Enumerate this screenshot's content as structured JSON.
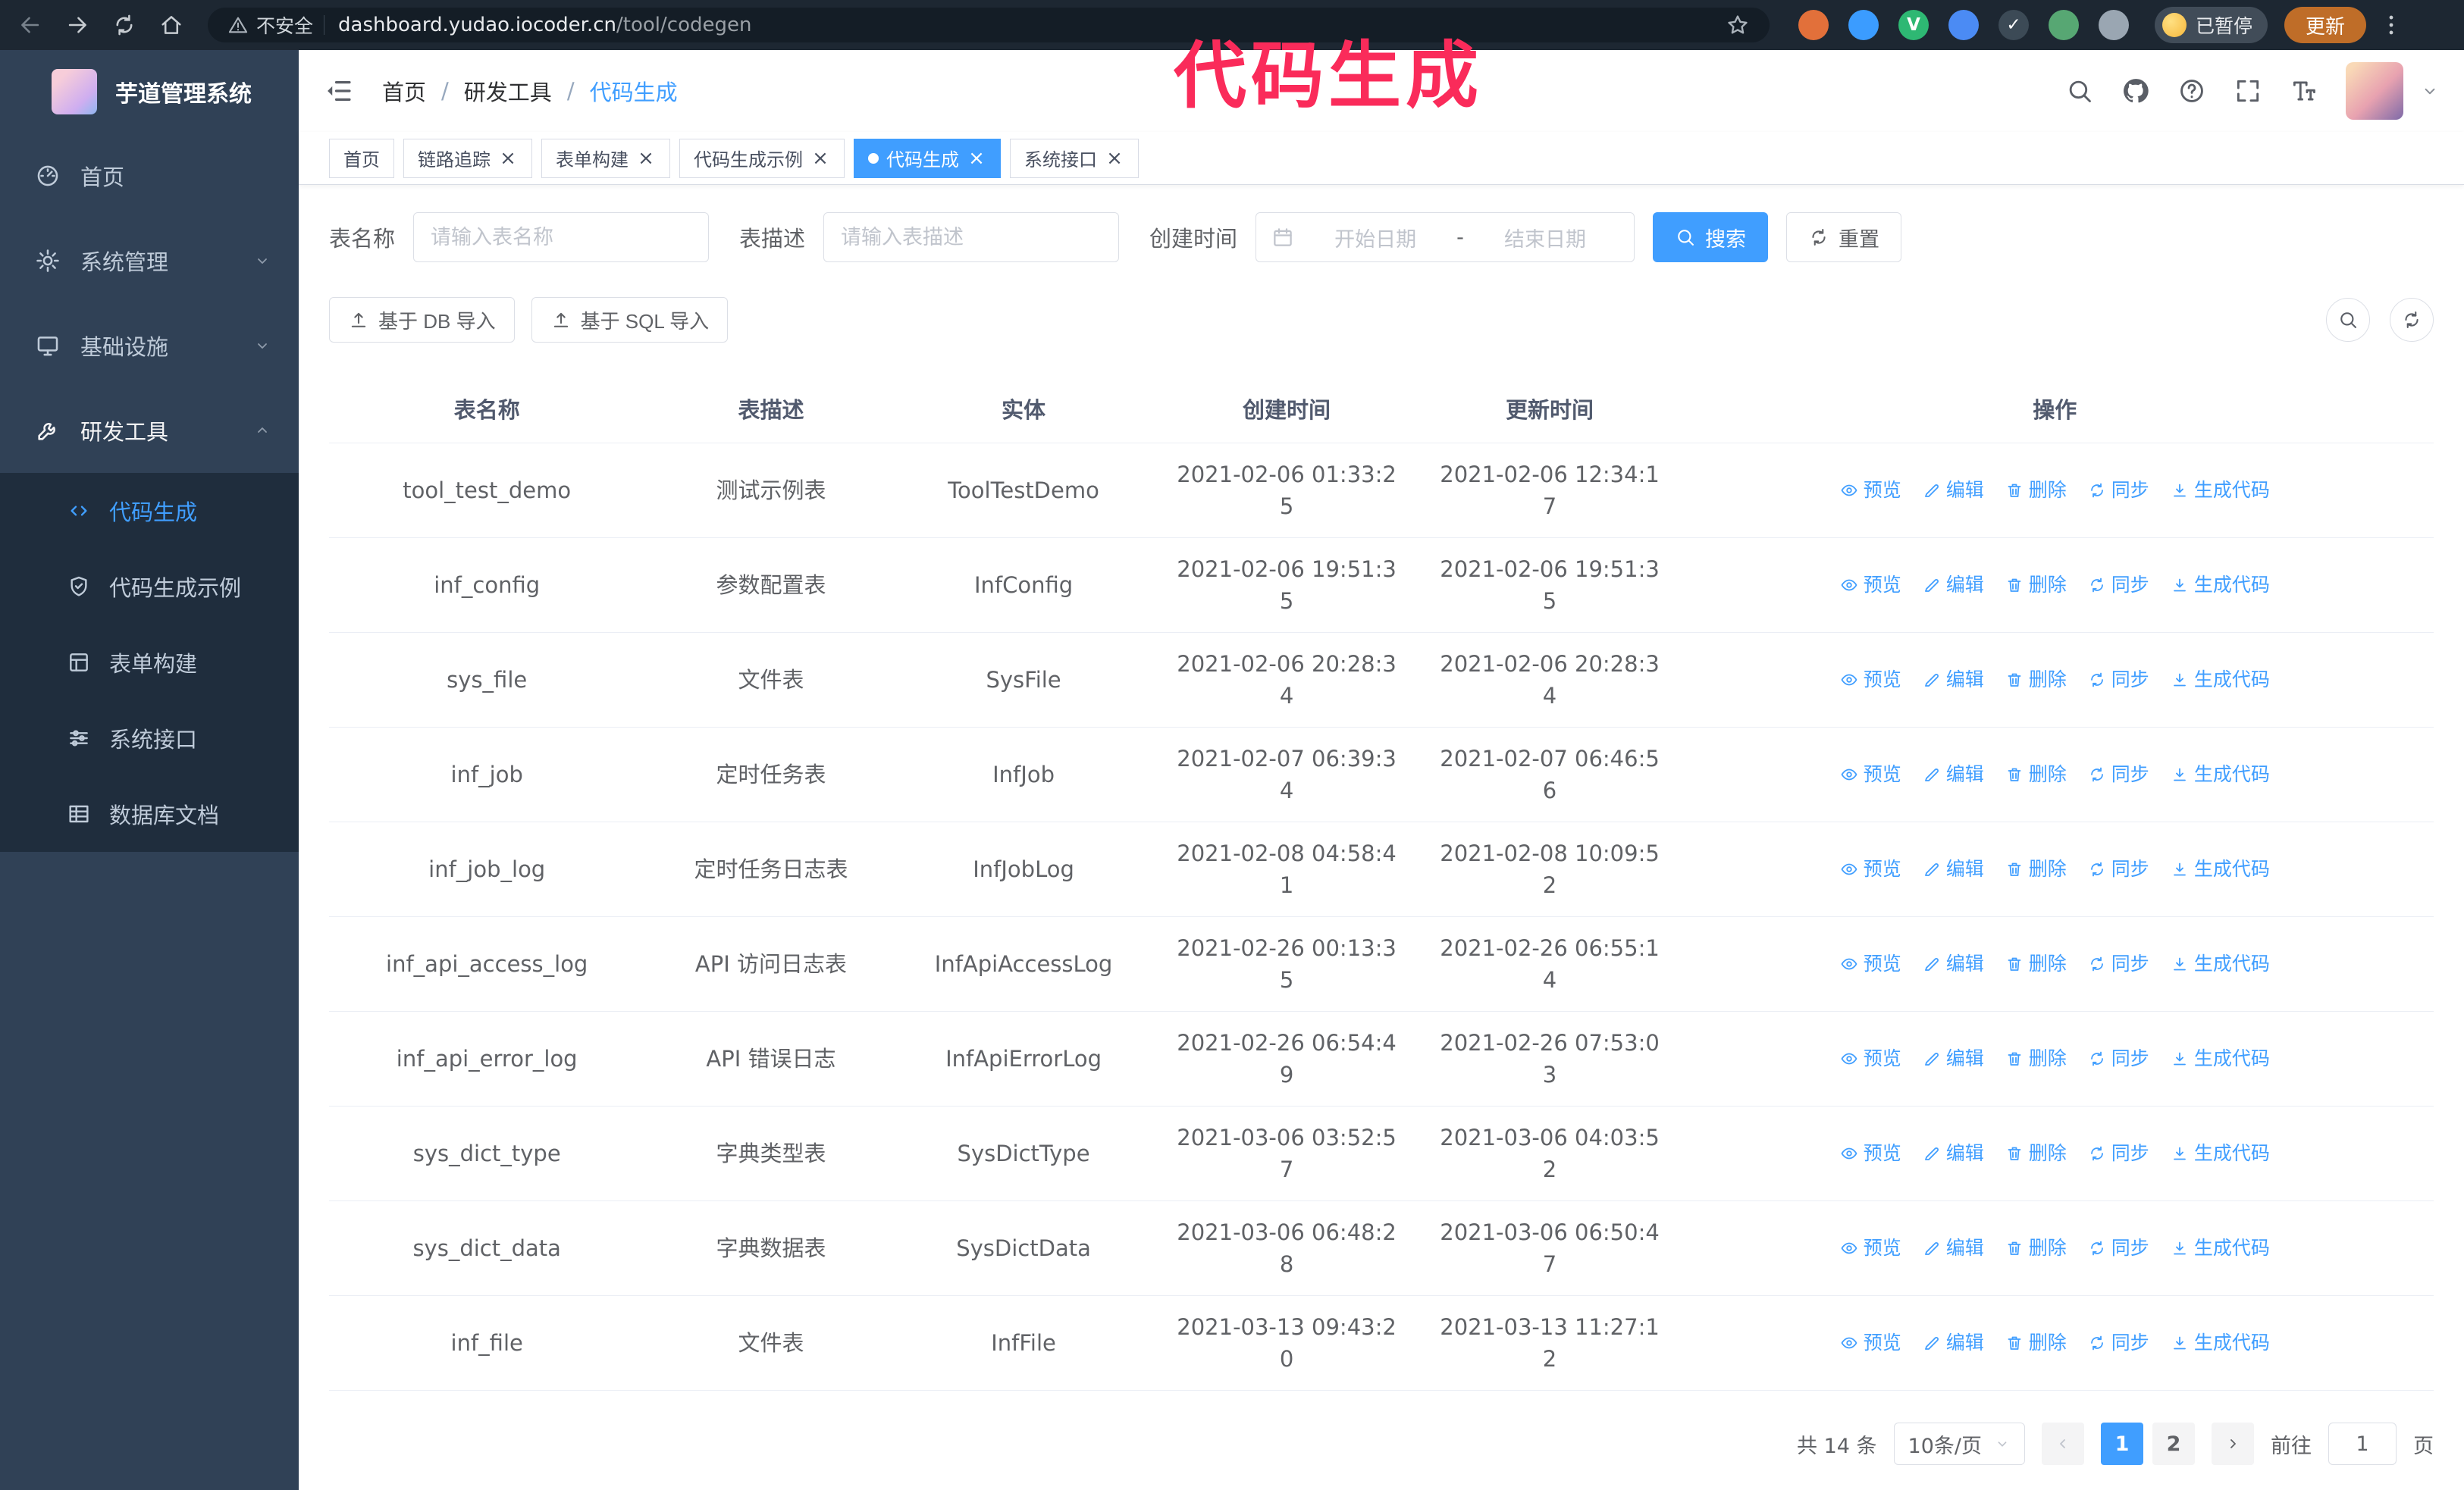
{
  "theme": {
    "accent": "#409eff",
    "sidebar_bg": "#304156",
    "submenu_bg": "#1f2d3d",
    "chrome_bg": "#1d2732",
    "annotation_color": "#fa2b5a",
    "update_button_bg": "#bf6d28"
  },
  "annotation": {
    "text": "代码生成"
  },
  "browser": {
    "security_label": "不安全",
    "url_host": "dashboard.yudao.iocoder.cn",
    "url_path": "/tool/codegen",
    "paused_badge": "已暂停",
    "update_button": "更新",
    "extensions": [
      {
        "name": "extension-orange-icon",
        "color": "#e2703a",
        "glyph": ""
      },
      {
        "name": "extension-blue-drop-icon",
        "color": "#3b9cff",
        "glyph": ""
      },
      {
        "name": "extension-green-v-icon",
        "color": "#2eb873",
        "glyph": "V"
      },
      {
        "name": "extension-people-icon",
        "color": "#4b8bf4",
        "glyph": ""
      },
      {
        "name": "extension-check-icon",
        "color": "#3c4a56",
        "glyph": "✓"
      },
      {
        "name": "extension-leaf-icon",
        "color": "#57a773",
        "glyph": ""
      },
      {
        "name": "extension-puzzle-icon",
        "color": "#9aa6b2",
        "glyph": ""
      }
    ]
  },
  "sidebar": {
    "logo_title": "芋道管理系统",
    "items": [
      {
        "label": "首页",
        "icon": "dashboard-icon",
        "expandable": false,
        "expanded": false
      },
      {
        "label": "系统管理",
        "icon": "gear-icon",
        "expandable": true,
        "expanded": false
      },
      {
        "label": "基础设施",
        "icon": "monitor-icon",
        "expandable": true,
        "expanded": false
      },
      {
        "label": "研发工具",
        "icon": "tool-icon",
        "expandable": true,
        "expanded": true
      }
    ],
    "submenu": [
      {
        "label": "代码生成",
        "icon": "code-icon",
        "active": true
      },
      {
        "label": "代码生成示例",
        "icon": "shield-icon",
        "active": false
      },
      {
        "label": "表单构建",
        "icon": "form-icon",
        "active": false
      },
      {
        "label": "系统接口",
        "icon": "sliders-icon",
        "active": false
      },
      {
        "label": "数据库文档",
        "icon": "table-icon",
        "active": false
      }
    ]
  },
  "breadcrumb": [
    "首页",
    "研发工具",
    "代码生成"
  ],
  "tabs": [
    {
      "label": "首页",
      "closable": false,
      "active": false
    },
    {
      "label": "链路追踪",
      "closable": true,
      "active": false
    },
    {
      "label": "表单构建",
      "closable": true,
      "active": false
    },
    {
      "label": "代码生成示例",
      "closable": true,
      "active": false
    },
    {
      "label": "代码生成",
      "closable": true,
      "active": true
    },
    {
      "label": "系统接口",
      "closable": true,
      "active": false
    }
  ],
  "filters": {
    "name_label": "表名称",
    "name_placeholder": "请输入表名称",
    "desc_label": "表描述",
    "desc_placeholder": "请输入表描述",
    "time_label": "创建时间",
    "start_placeholder": "开始日期",
    "range_separator": "-",
    "end_placeholder": "结束日期",
    "search_button": "搜索",
    "reset_button": "重置"
  },
  "toolbar": {
    "import_db": "基于 DB 导入",
    "import_sql": "基于 SQL 导入"
  },
  "table": {
    "columns": [
      "表名称",
      "表描述",
      "实体",
      "创建时间",
      "更新时间",
      "操作"
    ],
    "actions": [
      "预览",
      "编辑",
      "删除",
      "同步",
      "生成代码"
    ],
    "rows": [
      {
        "name": "tool_test_demo",
        "desc": "测试示例表",
        "entity": "ToolTestDemo",
        "created": "2021-02-06 01:33:25",
        "updated": "2021-02-06 12:34:17"
      },
      {
        "name": "inf_config",
        "desc": "参数配置表",
        "entity": "InfConfig",
        "created": "2021-02-06 19:51:35",
        "updated": "2021-02-06 19:51:35"
      },
      {
        "name": "sys_file",
        "desc": "文件表",
        "entity": "SysFile",
        "created": "2021-02-06 20:28:34",
        "updated": "2021-02-06 20:28:34"
      },
      {
        "name": "inf_job",
        "desc": "定时任务表",
        "entity": "InfJob",
        "created": "2021-02-07 06:39:34",
        "updated": "2021-02-07 06:46:56"
      },
      {
        "name": "inf_job_log",
        "desc": "定时任务日志表",
        "entity": "InfJobLog",
        "created": "2021-02-08 04:58:41",
        "updated": "2021-02-08 10:09:52"
      },
      {
        "name": "inf_api_access_log",
        "desc": "API 访问日志表",
        "entity": "InfApiAccessLog",
        "created": "2021-02-26 00:13:35",
        "updated": "2021-02-26 06:55:14"
      },
      {
        "name": "inf_api_error_log",
        "desc": "API 错误日志",
        "entity": "InfApiErrorLog",
        "created": "2021-02-26 06:54:49",
        "updated": "2021-02-26 07:53:03"
      },
      {
        "name": "sys_dict_type",
        "desc": "字典类型表",
        "entity": "SysDictType",
        "created": "2021-03-06 03:52:57",
        "updated": "2021-03-06 04:03:52"
      },
      {
        "name": "sys_dict_data",
        "desc": "字典数据表",
        "entity": "SysDictData",
        "created": "2021-03-06 06:48:28",
        "updated": "2021-03-06 06:50:47"
      },
      {
        "name": "inf_file",
        "desc": "文件表",
        "entity": "InfFile",
        "created": "2021-03-13 09:43:20",
        "updated": "2021-03-13 11:27:12"
      }
    ]
  },
  "pagination": {
    "total": "共 14 条",
    "page_size": "10条/页",
    "pages": [
      "1",
      "2"
    ],
    "active_page": "1",
    "goto_label": "前往",
    "goto_value": "1",
    "page_label": "页"
  }
}
